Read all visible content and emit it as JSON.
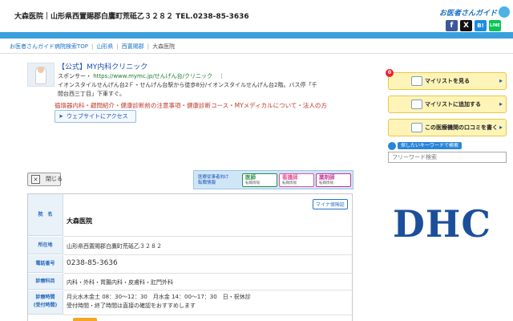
{
  "header": {
    "title": "大森医院｜山形県西置賜郡白鷹町荒砥乙３２８２ TEL.0238-85-3636",
    "logo": "お医者さんガイド",
    "social": [
      "f",
      "X",
      "B!",
      "LINE"
    ]
  },
  "breadcrumb": [
    "お医者さんガイド病院検索TOP",
    "山形県",
    "西置賜郡",
    "大森医院"
  ],
  "ad": {
    "title": "【公式】MY内科クリニック",
    "sponsor_label": "スポンサー・",
    "sponsor_url": "https://www.mymc.jp/せんげん台/クリニック",
    "sponsor_more": "⋮",
    "description": "イオンスタイルせんげん台2Ｆ・せんげん台駅から徒歩8分/イオンスタイルせんげん台2階。バス停「千間台西三丁目」下車すぐ。",
    "links": "循環器内科・顧問紹介・健康診断前の注意事項・健康診断コース・MYメディカルについて・法人の方",
    "website_button": "ウェブサイトにアクセス"
  },
  "sidebar": {
    "badge": "0",
    "buttons": [
      {
        "label": "マイリストを見る",
        "arrow": "▸"
      },
      {
        "label": "マイリストに追加する",
        "arrow": "▸"
      },
      {
        "label": "この医療機関の口コミを書く",
        "arrow": "▸"
      }
    ],
    "search_tag": "探したいキーワードで検索",
    "search_placeholder": "フリーワード検索",
    "banner": "DHC"
  },
  "close_button": "閉じる",
  "close_icon_glyph": "×",
  "recruit": {
    "text_line1": "医療従事者向け",
    "text_line2": "転職情報",
    "tags": [
      {
        "label": "医師",
        "sub": "転職情報"
      },
      {
        "label": "看護師",
        "sub": "転職情報"
      },
      {
        "label": "薬剤師",
        "sub": "転職情報"
      }
    ]
  },
  "clinic": {
    "mynacard": "マイナ保険証",
    "rows": [
      {
        "header": "院　名",
        "value": "大森医院"
      },
      {
        "header": "所在地",
        "value": "山形県西置賜郡白鷹町荒砥乙３２８２"
      },
      {
        "header": "電話番号",
        "value": "0238-85-3636"
      },
      {
        "header": "診療科目",
        "value": "内科・外科・胃腸内科・皮膚科・肛門外科"
      },
      {
        "header": "診療時間\n(受付時間)",
        "value": "月火水木金土 08：30～12：30　月水金 14：00～17：30　日・祝休診"
      }
    ],
    "hours_note": "受付時間・終了時間は直接の確認をおすすめします"
  }
}
